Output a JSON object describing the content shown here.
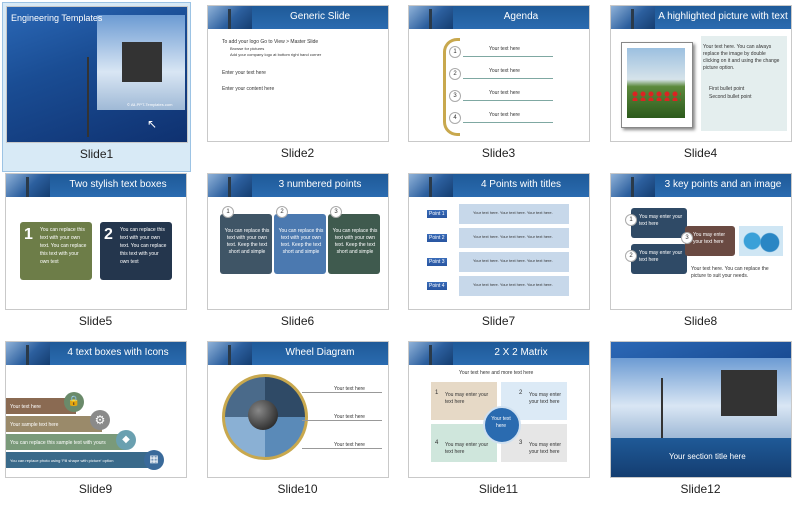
{
  "slides": [
    {
      "caption": "Slide1",
      "title": "Engineering Templates",
      "sub": "© All-PPT-Templates.com",
      "selected": true
    },
    {
      "caption": "Slide2",
      "title": "Generic Slide",
      "bullets": [
        "To add your logo Go to View > Master Slide",
        "Browse for pictures",
        "Add your company logo at bottom right hand corner",
        "Enter your text here",
        "Enter your content here"
      ]
    },
    {
      "caption": "Slide3",
      "title": "Agenda",
      "item": "Your text here",
      "nums": [
        "1",
        "2",
        "3",
        "4"
      ]
    },
    {
      "caption": "Slide4",
      "title": "A highlighted picture with text",
      "body": "Your text here. You can always replace the image by double clicking on it and using the change picture option.",
      "b1": "First bullet point",
      "b2": "Second bullet point"
    },
    {
      "caption": "Slide5",
      "title": "Two stylish text boxes",
      "n1": "1",
      "n2": "2",
      "body": "You can replace this text with your own text. You can replace this text with your own text"
    },
    {
      "caption": "Slide6",
      "title": "3 numbered points",
      "nums": [
        "1",
        "2",
        "3"
      ],
      "body": "You can replace this text with your own text. Keep the text short and simple"
    },
    {
      "caption": "Slide7",
      "title": "4 Points with titles",
      "points": [
        "Point 1",
        "Point 2",
        "Point 3",
        "Point 4"
      ],
      "body": "Your text here. Your text here. Your text here."
    },
    {
      "caption": "Slide8",
      "title": "3 key points and an image",
      "enter": "You may enter your text here",
      "nums": [
        "1",
        "2",
        "3"
      ],
      "body": "Your text here. You can replace the picture to suit your needs."
    },
    {
      "caption": "Slide9",
      "title": "4 text boxes with Icons",
      "rows": [
        "Your text here",
        "Your sample text here",
        "You can replace this sample text with yours",
        "You can replace photo using 'Fill shape with picture' option"
      ]
    },
    {
      "caption": "Slide10",
      "title": "Wheel Diagram",
      "item": "Your text here"
    },
    {
      "caption": "Slide11",
      "title": "2 X 2 Matrix",
      "top": "Your text here and more text here",
      "enter": "You may enter your text here",
      "center": "Your text here",
      "nums": [
        "1",
        "2",
        "3",
        "4"
      ]
    },
    {
      "caption": "Slide12",
      "section": "Your section title here"
    }
  ],
  "colors": {
    "header": "#2a6bb0",
    "select": "#d8eaf6"
  }
}
